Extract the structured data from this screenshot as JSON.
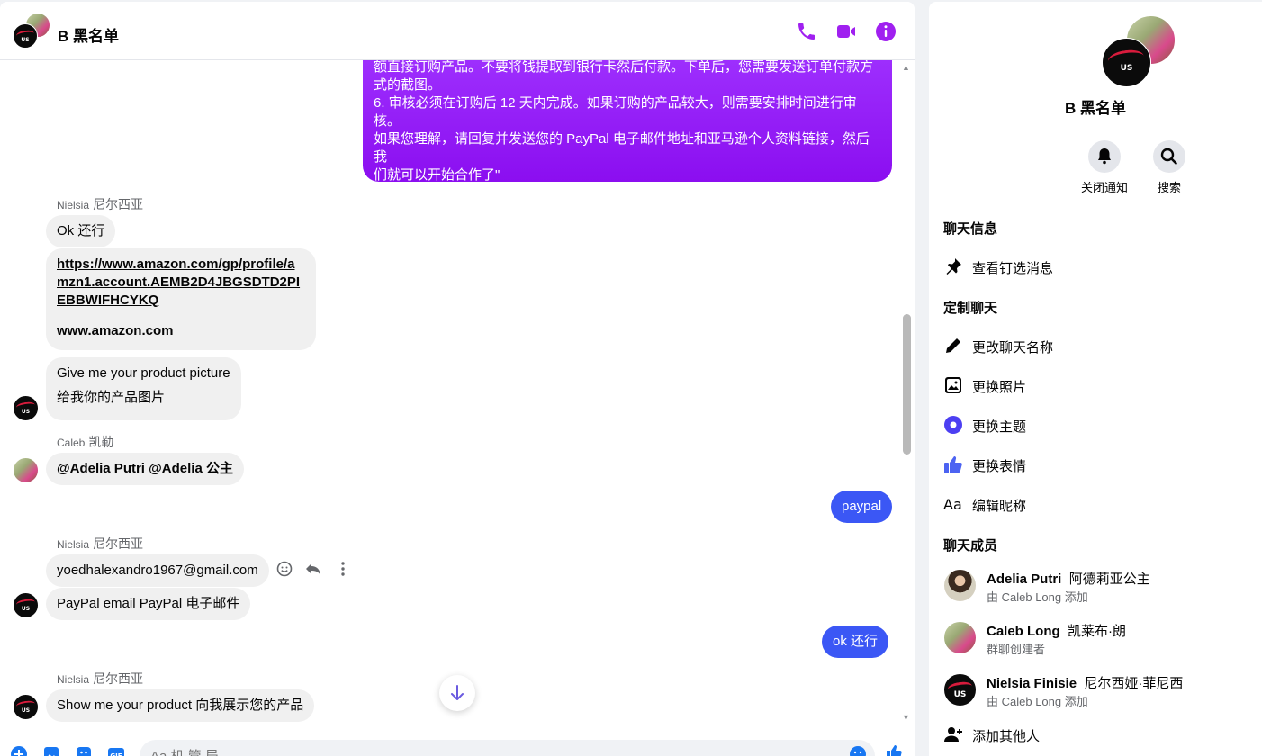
{
  "colors": {
    "accent": "#a033ff",
    "blue_bubble": "#3b57f5",
    "incoming_bubble": "#f0f0f0",
    "icon_purple": "#a020f0",
    "theme_icon": "#4c3ff2",
    "thumb_icon": "#4c63f2"
  },
  "header": {
    "title": "B 黑名单",
    "icons": [
      "phone-icon",
      "video-icon",
      "info-icon"
    ]
  },
  "messages": {
    "outgoing_long": {
      "lines": [
        "额直接订购产品。不要将钱提取到银行卡然后付款。下单后，您需要发送订单付款方",
        "式的截图。",
        "6. 审核必须在订购后 12 天内完成。如果订购的产品较大，则需要安排时间进行审",
        "核。",
        "如果您理解，请回复并发送您的 PayPal 电子邮件地址和亚马逊个人资料链接，然后我",
        "们就可以开始合作了\""
      ]
    },
    "group1": {
      "sender_name": "Nielsia",
      "sender_cn": "尼尔西亚",
      "msg1": "Ok  还行",
      "link": "https://www.amazon.com/gp/profile/amzn1.account.AEMB2D4JBGSDTD2PIEBBWIFHCYKQ",
      "domain": "www.amazon.com",
      "msg3_en": "Give me your product picture",
      "msg3_cn": "给我你的产品图片"
    },
    "group2": {
      "sender_name": "Caleb",
      "sender_cn": "凯勒",
      "msg": "@Adelia Putri  @Adelia 公主"
    },
    "out_paypal": "paypal",
    "group3": {
      "sender_name": "Nielsia",
      "sender_cn": "尼尔西亚",
      "msg1": "yoedhalexandro1967@gmail.com",
      "msg2": "PayPal email  PayPal 电子邮件"
    },
    "out_ok": "ok  还行",
    "group4": {
      "sender_name": "Nielsia",
      "sender_cn": "尼尔西亚",
      "msg": "Show me your product  向我展示您的产品"
    }
  },
  "composer": {
    "placeholder": "Aa 机 管 局",
    "icons": [
      "plus-icon",
      "image-icon",
      "sticker-icon",
      "gif-icon",
      "emoji-icon",
      "like-icon"
    ]
  },
  "info": {
    "title": "B 黑名单",
    "mute_label": "关闭通知",
    "search_label": "搜索",
    "chat_info_heading": "聊天信息",
    "pinned_label": "查看钉选消息",
    "customize_heading": "定制聊天",
    "rename_label": "更改聊天名称",
    "photo_label": "更换照片",
    "theme_label": "更换主题",
    "emoji_label": "更换表情",
    "nickname_label": "编辑昵称",
    "members_heading": "聊天成员",
    "members": [
      {
        "name": "Adelia Putri",
        "cn": "阿德莉亚公主",
        "sub": "由 Caleb Long 添加"
      },
      {
        "name": "Caleb Long",
        "cn": "凯莱布·朗",
        "sub": "群聊创建者"
      },
      {
        "name": "Nielsia Finisie",
        "cn": "尼尔西娅·菲尼西",
        "sub": "由 Caleb Long 添加"
      }
    ],
    "add_people_label": "添加其他人"
  }
}
